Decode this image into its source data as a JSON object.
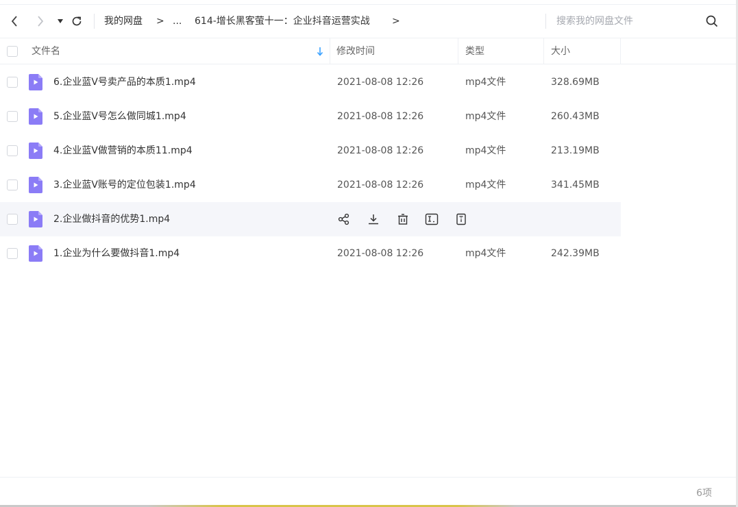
{
  "toolbar": {
    "back_icon": "chevron-left-icon",
    "forward_icon": "chevron-right-icon",
    "dropdown_icon": "caret-down-icon",
    "refresh_icon": "refresh-icon"
  },
  "breadcrumb": {
    "root": "我的网盘",
    "sep1": ">",
    "ellipsis": "...",
    "sep2": ">",
    "current": "614-增长黑客萤十一：企业抖音运营实战",
    "sep3": ">"
  },
  "search": {
    "placeholder": "搜索我的网盘文件",
    "icon": "search-icon"
  },
  "columns": {
    "name": "文件名",
    "modified": "修改时间",
    "type": "类型",
    "size": "大小"
  },
  "files": [
    {
      "name": "6.企业蓝V号卖产品的本质1.mp4",
      "modified": "2021-08-08 12:26",
      "type": "mp4文件",
      "size": "328.69MB"
    },
    {
      "name": "5.企业蓝V号怎么做同城1.mp4",
      "modified": "2021-08-08 12:26",
      "type": "mp4文件",
      "size": "260.43MB"
    },
    {
      "name": "4.企业蓝V做营销的本质11.mp4",
      "modified": "2021-08-08 12:26",
      "type": "mp4文件",
      "size": "213.19MB"
    },
    {
      "name": "3.企业蓝V账号的定位包装1.mp4",
      "modified": "2021-08-08 12:26",
      "type": "mp4文件",
      "size": "341.45MB"
    },
    {
      "name": "2.企业做抖音的优势1.mp4",
      "modified": "",
      "type": "",
      "size": ""
    },
    {
      "name": "1.企业为什么要做抖音1.mp4",
      "modified": "2021-08-08 12:26",
      "type": "mp4文件",
      "size": "242.39MB"
    }
  ],
  "row_actions": [
    "share-icon",
    "download-icon",
    "delete-icon",
    "rename-icon",
    "more-info-icon"
  ],
  "footer": {
    "count": "6项"
  },
  "colors": {
    "accent": "#3aa1ff",
    "file_icon": "#8b7cf6",
    "hover_row": "#f5f6fa"
  }
}
